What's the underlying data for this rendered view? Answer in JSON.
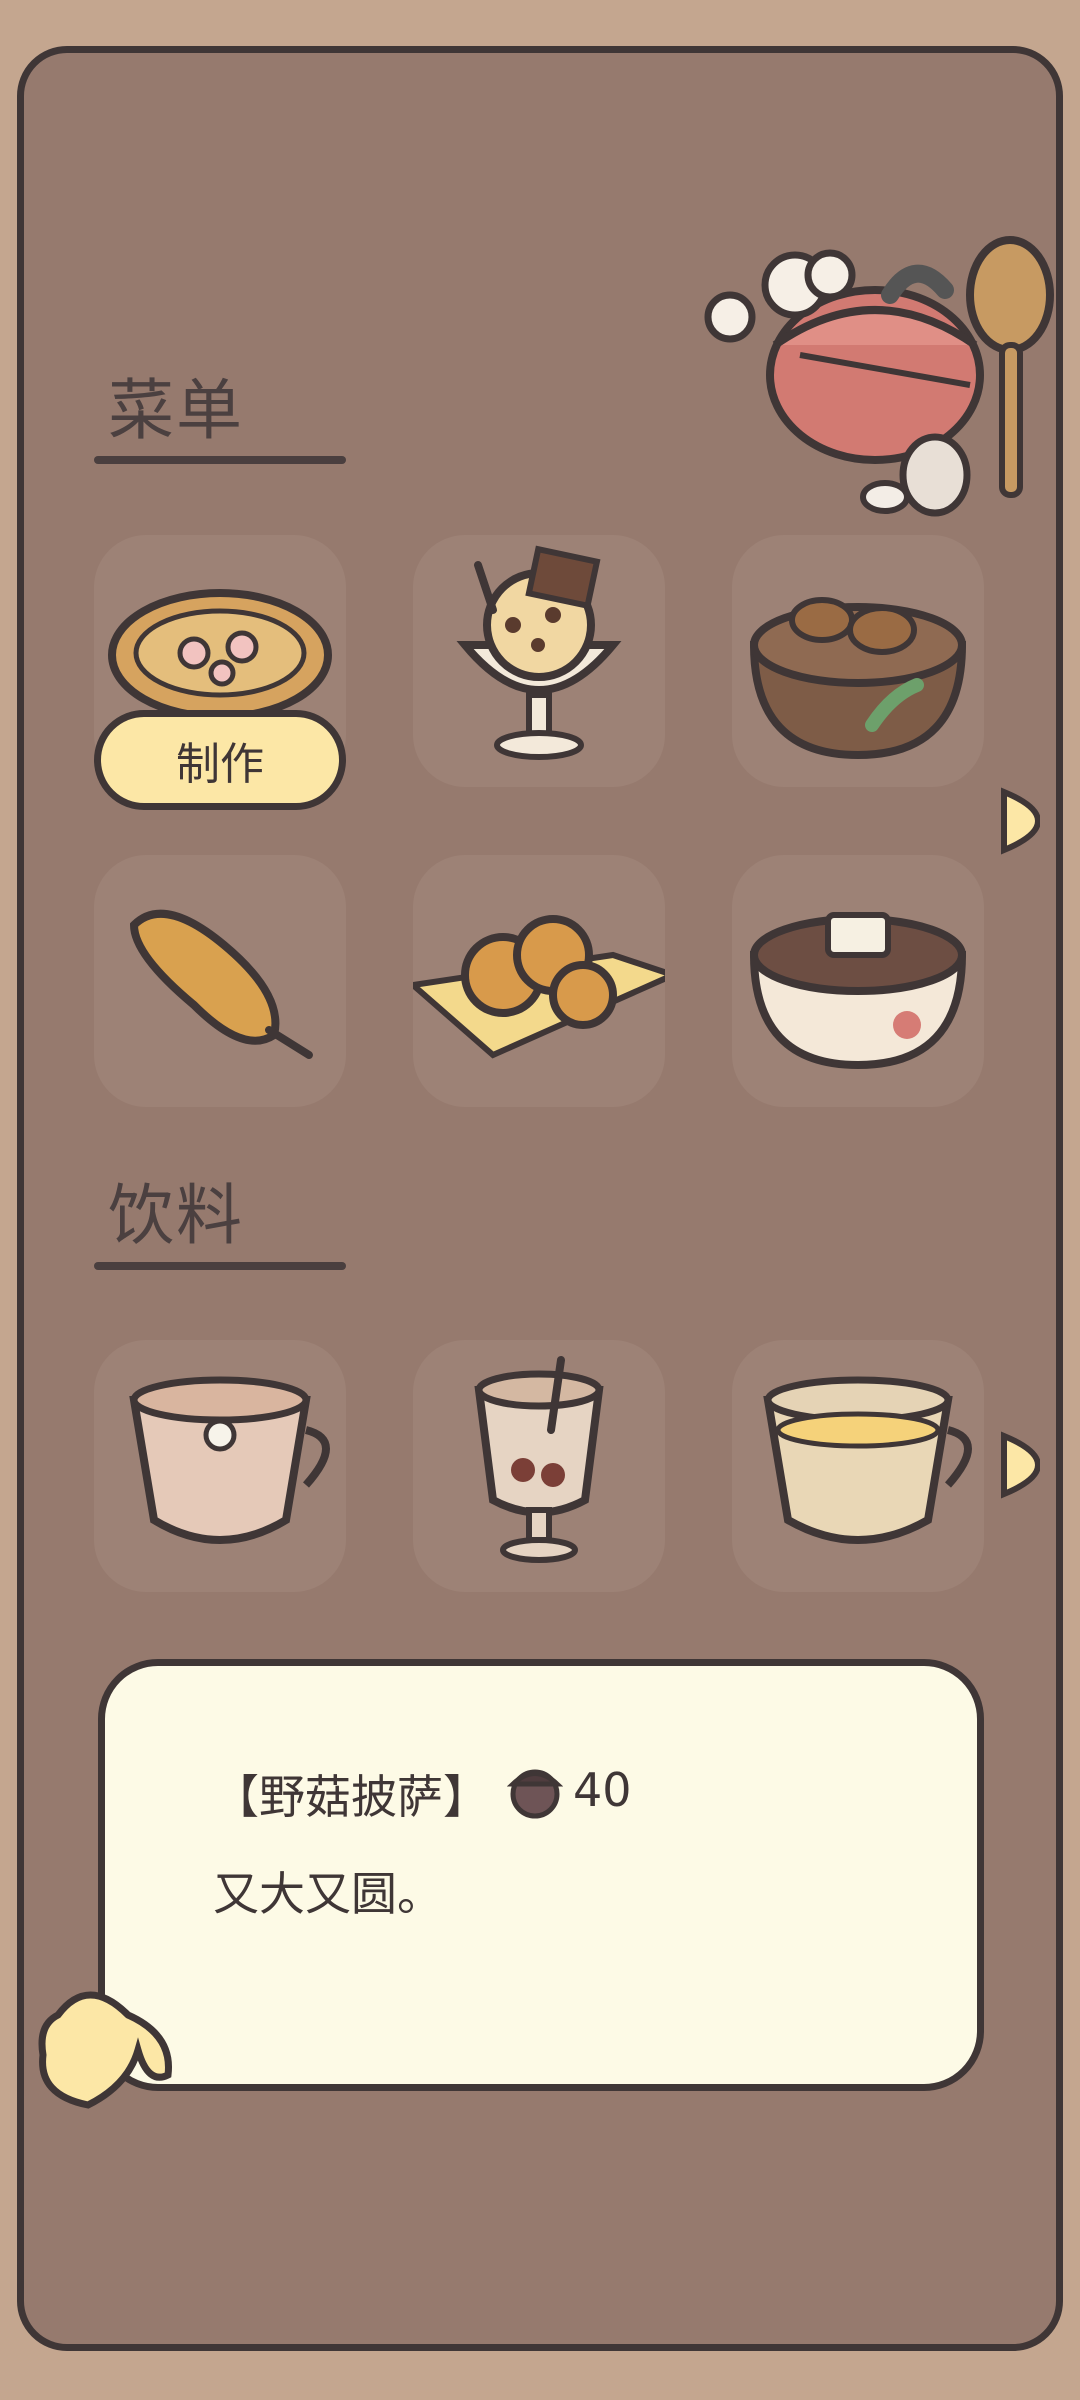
{
  "sections": {
    "menu_title": "菜单",
    "drinks_title": "饮料"
  },
  "menu_items": [
    {
      "name": "pizza",
      "icon": "mushroom-pizza-icon",
      "selected": true
    },
    {
      "name": "sundae",
      "icon": "chocolate-sundae-icon"
    },
    {
      "name": "mushroom-soup",
      "icon": "mushroom-soup-icon"
    },
    {
      "name": "corn-dog",
      "icon": "corn-dog-icon"
    },
    {
      "name": "pretzel",
      "icon": "pretzel-icon"
    },
    {
      "name": "tofu-bowl",
      "icon": "tofu-bowl-icon"
    }
  ],
  "drink_items": [
    {
      "name": "flower-tea",
      "icon": "flower-tea-icon"
    },
    {
      "name": "mocha-glass",
      "icon": "mocha-glass-icon"
    },
    {
      "name": "honey-tea",
      "icon": "honey-tea-icon"
    }
  ],
  "make_button": {
    "label": "制作"
  },
  "detail": {
    "name": "【野菇披萨】",
    "price": "40",
    "description": "又大又圆。",
    "currency_icon": "acorn-icon"
  },
  "colors": {
    "background": "#C4A68F",
    "panel": "#967A6E",
    "tile": "#9D8276",
    "button": "#FCE7A6",
    "card": "#FDFAE6",
    "outline": "#3F3636"
  }
}
